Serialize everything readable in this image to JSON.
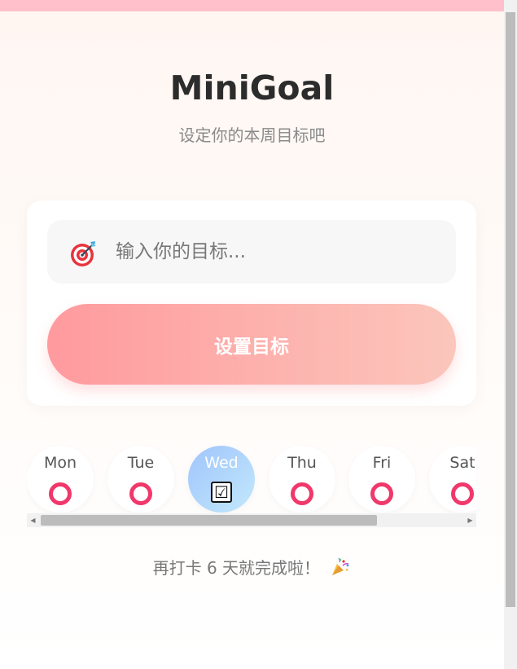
{
  "app": {
    "title": "MiniGoal",
    "subtitle": "设定你的本周目标吧"
  },
  "goal_form": {
    "icon": "target-icon",
    "input_value": "",
    "input_placeholder": "输入你的目标...",
    "submit_label": "设置目标"
  },
  "days": [
    {
      "label": "Mon",
      "checked": false
    },
    {
      "label": "Tue",
      "checked": false
    },
    {
      "label": "Wed",
      "checked": true,
      "mark": "☑"
    },
    {
      "label": "Thu",
      "checked": false
    },
    {
      "label": "Fri",
      "checked": false
    },
    {
      "label": "Sat",
      "checked": false
    }
  ],
  "progress": {
    "text": "再打卡 6 天就完成啦！",
    "icon": "party-popper-icon"
  },
  "colors": {
    "accent_ring": "#f0386b",
    "button_gradient_start": "#ff9a9e",
    "button_gradient_end": "#fbc6bb",
    "active_day_start": "#a1c4fd",
    "active_day_end": "#c2e9fb",
    "top_bar": "#ffbfcb"
  }
}
